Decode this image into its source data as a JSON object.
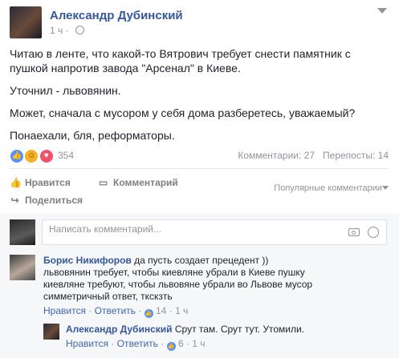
{
  "post": {
    "author": "Александр Дубинский",
    "time": "1 ч",
    "paragraphs": [
      "Читаю в ленте, что какой-то Вятрович требует снести памятник с пушкой напротив завода \"Арсенал\" в Киеве.",
      "Уточнил - львовянин.",
      "Может, сначала с мусором у себя дома разберетесь, уважаемый?",
      "Понаехали, бля, реформаторы."
    ],
    "reaction_count": "354",
    "comments_count": "Комментарии: 27",
    "shares_count": "Перепосты: 14",
    "reactions": [
      "like-icon",
      "haha-icon",
      "love-icon"
    ]
  },
  "actions": {
    "like": "Нравится",
    "comment": "Комментарий",
    "share": "Поделиться",
    "sort": "Популярные комментарии"
  },
  "composer": {
    "placeholder": "Написать комментарий..."
  },
  "comments": [
    {
      "author": "Борис Никифоров",
      "text_lines": [
        "да пусть создает прецедент ))",
        "львовянин требует, чтобы киевляне убрали в Киеве пушку",
        "киевляне требуют, чтобы львовяне убрали во Львове мусор",
        "симметричный ответ, ткскзть"
      ],
      "like_label": "Нравится",
      "reply_label": "Ответить",
      "likes": "14",
      "time": "1 ч"
    },
    {
      "author": "Александр Дубинский",
      "text": "Срут там. Срут тут. Утомили.",
      "like_label": "Нравится",
      "reply_label": "Ответить",
      "likes": "6",
      "time": "1 ч"
    }
  ],
  "colors": {
    "link": "#365899",
    "meta": "#90949c",
    "like_blue": "#5890ff",
    "comments_bg": "#f6f7f9"
  }
}
